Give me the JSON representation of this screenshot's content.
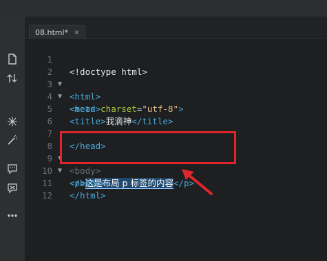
{
  "tab": {
    "label": "08.html*",
    "close": "×"
  },
  "sidebar": {
    "icons": [
      "file-icon",
      "sort-icon",
      "cursor-move-icon",
      "magic-wand-icon",
      "comment-icon",
      "comment-off-icon",
      "more-icon"
    ]
  },
  "code": {
    "l1": {
      "n": "1",
      "text": "<!doctype html>"
    },
    "l2": {
      "n": "2",
      "fold": "▼",
      "open": "<html>"
    },
    "l3": {
      "n": "3",
      "fold": "▼",
      "open": "<head>"
    },
    "l4": {
      "n": "4",
      "t1": "<meta ",
      "attr": "charset",
      "eq": "=",
      "val": "\"utf-8\"",
      "t2": ">"
    },
    "l5": {
      "n": "5",
      "t1": "<title>",
      "text": "我滴神",
      "t2": "</title>"
    },
    "l6": {
      "n": "6"
    },
    "l7": {
      "n": "7",
      "close": "</head>"
    },
    "l8": {
      "n": "8",
      "fold": "▼",
      "open": "<body>"
    },
    "l9": {
      "n": "9",
      "fold": "▼",
      "t1": "<p>",
      "selected": "这是布局 p 标签的内容",
      "t2": "</p>"
    },
    "l10": {
      "n": "10",
      "close": "</body>"
    },
    "l11": {
      "n": "11",
      "close": "</html>"
    },
    "l12": {
      "n": "12"
    }
  },
  "colors": {
    "annotation": "#e0262c",
    "tag": "#49a9d8",
    "attr": "#b0c73c",
    "string": "#e2c08d"
  }
}
